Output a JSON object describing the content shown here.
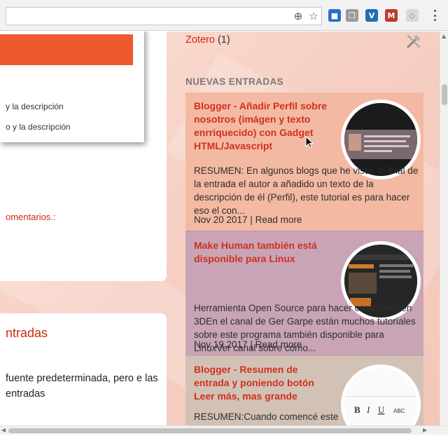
{
  "browser": {
    "icons": [
      "zoom-icon",
      "bookmark-star-icon",
      "zotero-save-icon",
      "copy-icon",
      "vimeo-icon",
      "gmail-icon",
      "tag-icon",
      "menu-icon"
    ]
  },
  "left": {
    "popup_line_1": "y la descripción",
    "popup_line_2": "o y la descripción",
    "comments_link": "omentarios.:",
    "card_title": "ntradas",
    "card_text": "fuente predeterminada, pero e las entradas"
  },
  "sidebar": {
    "zotero_label": "Zotero",
    "zotero_count": "(1)",
    "section_title": "NUEVAS ENTRADAS",
    "posts": [
      {
        "title": "Blogger - Añadir Perfil sobre nosotros (imágen y texto enrriquecido) con Gadget HTML/Javascript",
        "summary": "RESUMEN: En algunos blogs que he visto, al final de la entrada el autor a añadido un texto de la descripción de él (Perfil), este tutorial es para hacer eso el con...",
        "date": "Nov 20 2017",
        "separator": "|",
        "read_more": "Read more",
        "color": "#f4b9a2"
      },
      {
        "title": "Make Human también está disponible para Linux",
        "summary": "Herramienta Open Source para hacer caracteres en 3DEn el canal de Ger Garpe están muchos tutoriales sobre este programa también disponible para LinuxVer canal sobre cómo...",
        "date": "Nov 19 2017",
        "separator": "|",
        "read_more": "Read more",
        "color": "#c8a4b6"
      },
      {
        "title": "Blogger - Resumen de entrada y poniendo botón Leer más, mas grande",
        "summary": "RESUMEN:Cuando comencé este",
        "color": "#d2c2b6"
      }
    ]
  },
  "thumb_texts": {
    "editor_buttons": [
      "B",
      "I",
      "U",
      "ABC"
    ]
  },
  "colors": {
    "accent": "#ee5a2b",
    "link": "#cc2a10",
    "page_bg": "#f6cfc3"
  }
}
